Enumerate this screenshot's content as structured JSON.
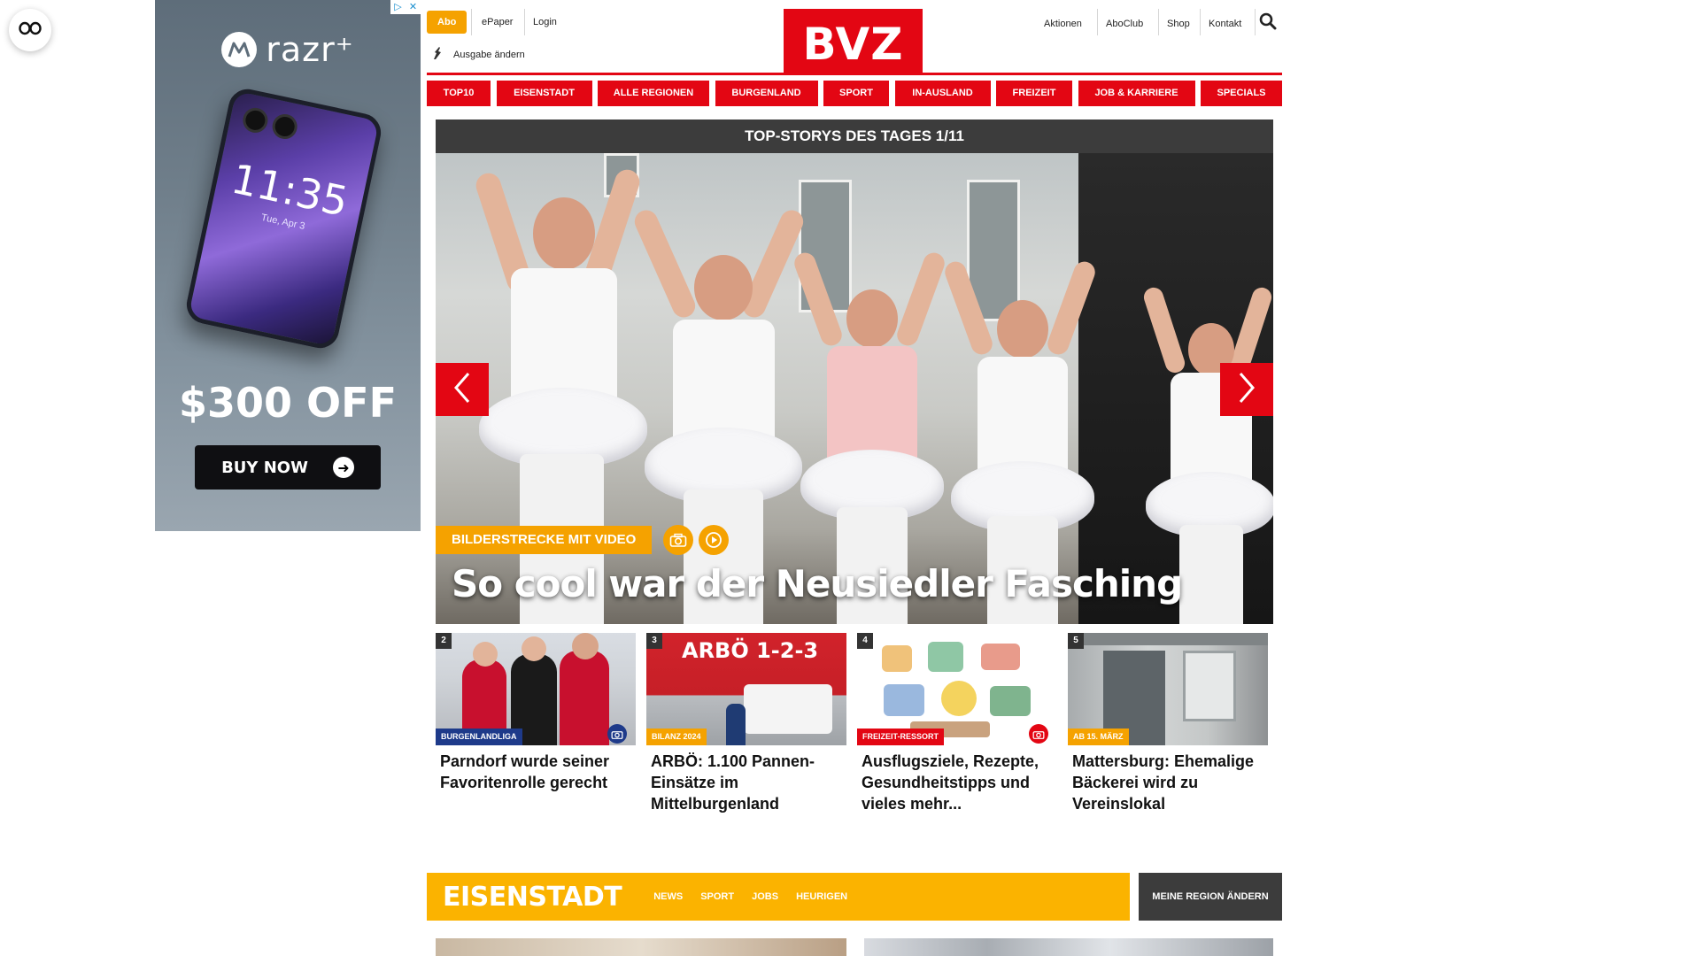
{
  "header": {
    "abo_label": "Abo",
    "epaper_label": "ePaper",
    "login_label": "Login",
    "edition_label": "Ausgabe ändern",
    "logo_text": "BVZ",
    "links": [
      "Aktionen",
      "AboClub",
      "Shop",
      "Kontakt"
    ]
  },
  "nav": {
    "items": [
      "TOP10",
      "EISENSTADT",
      "ALLE REGIONEN",
      "BURGENLAND",
      "SPORT",
      "IN-AUSLAND",
      "FREIZEIT",
      "JOB & KARRIERE",
      "SPECIALS"
    ]
  },
  "ad": {
    "brand": "razr⁺",
    "phone_time": "11:35",
    "phone_date": "Tue, Apr 3",
    "offer": "$300 OFF",
    "cta": "BUY NOW"
  },
  "carousel": {
    "title": "TOP-STORYS DES TAGES 1/11",
    "kicker": "BILDERSTRECKE MIT VIDEO",
    "headline": "So cool war der Neusiedler Fasching"
  },
  "teasers": [
    {
      "num": "2",
      "tag": "BURGENLANDLIGA",
      "title": "Parndorf wurde seiner Favoritenrolle gerecht"
    },
    {
      "num": "3",
      "tag": "BILANZ 2024",
      "title": "ARBÖ: 1.100 Pannen-Einsätze im Mittelburgenland",
      "sign": "ARBÖ 1-2-3"
    },
    {
      "num": "4",
      "tag": "FREIZEIT-RESSORT",
      "title": "Ausflugsziele, Rezepte, Gesundheitstipps und vieles mehr..."
    },
    {
      "num": "5",
      "tag": "AB 15. MÄRZ",
      "title": "Mattersburg: Ehemalige Bäckerei wird zu Vereinslokal"
    }
  ],
  "region": {
    "name": "EISENSTADT",
    "links": [
      "NEWS",
      "SPORT",
      "JOBS",
      "HEURIGEN"
    ],
    "change_label": "MEINE REGION ÄNDERN"
  },
  "colors": {
    "brand_red": "#e30613",
    "accent_orange": "#f5a200",
    "region_yellow": "#fbb300",
    "dark_bar": "#3c3c3c"
  }
}
